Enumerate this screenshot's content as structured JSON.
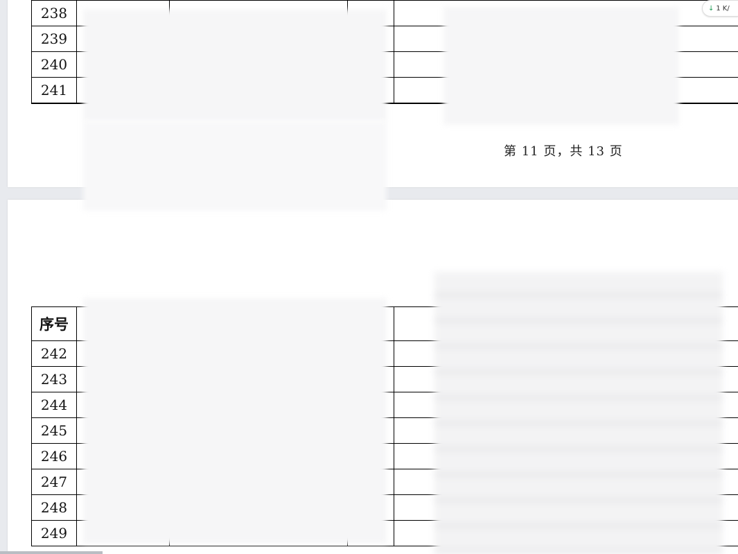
{
  "page_top": {
    "rows": [
      "238",
      "239",
      "240",
      "241"
    ],
    "footer": "第 11 页，共 13 页"
  },
  "page_bottom": {
    "header_label": "序号",
    "rows": [
      "242",
      "243",
      "244",
      "245",
      "246",
      "247",
      "248",
      "249"
    ]
  },
  "badge": {
    "icon": "down-arrow-icon",
    "count": "1",
    "suffix": "K/"
  }
}
